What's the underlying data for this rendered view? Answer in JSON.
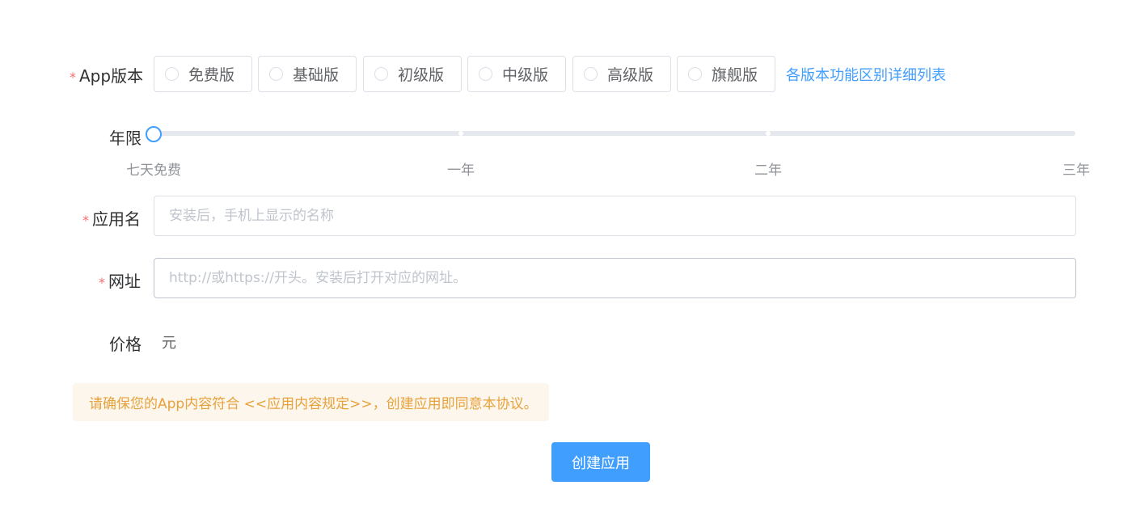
{
  "form": {
    "version": {
      "label": "App版本",
      "required_mark": "*",
      "options": [
        "免费版",
        "基础版",
        "初级版",
        "中级版",
        "高级版",
        "旗舰版"
      ],
      "compare_link": "各版本功能区别详细列表"
    },
    "duration": {
      "label": "年限",
      "marks": [
        "七天免费",
        "一年",
        "二年",
        "三年"
      ],
      "selected_index": 0
    },
    "app_name": {
      "label": "应用名",
      "required_mark": "*",
      "value": "",
      "placeholder": "安装后，手机上显示的名称"
    },
    "url": {
      "label": "网址",
      "required_mark": "*",
      "value": "",
      "placeholder": "http://或https://开头。安装后打开对应的网址。"
    },
    "price": {
      "label": "价格",
      "value": "",
      "unit": "元"
    }
  },
  "notice": {
    "text": "请确保您的App内容符合 <<应用内容规定>>，创建应用即同意本协议。",
    "color": "#e6a23c",
    "background": "#fdf6ec"
  },
  "submit_label": "创建应用",
  "colors": {
    "primary": "#409eff",
    "required": "#f56c6c",
    "border": "#dcdfe6"
  }
}
